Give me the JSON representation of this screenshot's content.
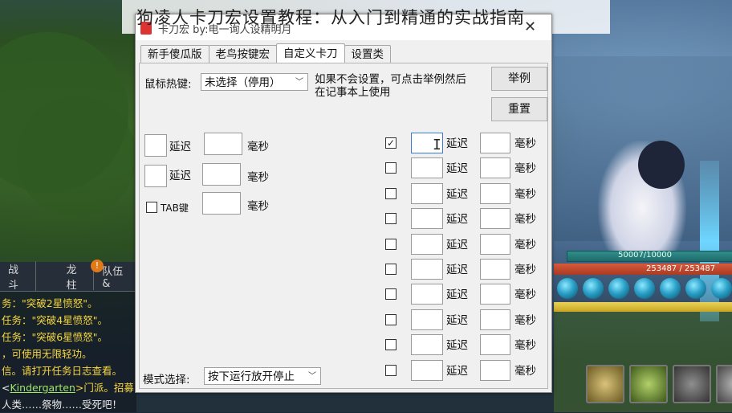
{
  "banner": {
    "title": "狗凌人卡刀宏设置教程：从入门到精通的实战指南"
  },
  "window": {
    "title": "卡刀宏 by:电一询人设精明月",
    "close": "✕"
  },
  "tabs": [
    {
      "label": "新手傻瓜版",
      "active": false
    },
    {
      "label": "老鸟按键宏",
      "active": false
    },
    {
      "label": "自定义卡刀",
      "active": true
    },
    {
      "label": "设置类",
      "active": false
    }
  ],
  "hotkey": {
    "label": "鼠标热键:",
    "value": "未选择（停用）"
  },
  "hint": {
    "line1": "如果不会设置，可点击举例然后",
    "line2": "在记事本上使用"
  },
  "buttons": {
    "example": "举例",
    "reset": "重置"
  },
  "left_rows": [
    {
      "prefix": "",
      "delay_label": "延迟",
      "unit": "毫秒"
    },
    {
      "prefix": "",
      "delay_label": "延迟",
      "unit": "毫秒"
    },
    {
      "prefix": "TAB键",
      "delay_label": "",
      "unit": "毫秒"
    }
  ],
  "right_rows": [
    {
      "checked": true,
      "delay_label": "延迟",
      "unit": "毫秒"
    },
    {
      "checked": false,
      "delay_label": "延迟",
      "unit": "毫秒"
    },
    {
      "checked": false,
      "delay_label": "延迟",
      "unit": "毫秒"
    },
    {
      "checked": false,
      "delay_label": "延迟",
      "unit": "毫秒"
    },
    {
      "checked": false,
      "delay_label": "延迟",
      "unit": "毫秒"
    },
    {
      "checked": false,
      "delay_label": "延迟",
      "unit": "毫秒"
    },
    {
      "checked": false,
      "delay_label": "延迟",
      "unit": "毫秒"
    },
    {
      "checked": false,
      "delay_label": "延迟",
      "unit": "毫秒"
    },
    {
      "checked": false,
      "delay_label": "延迟",
      "unit": "毫秒"
    },
    {
      "checked": false,
      "delay_label": "延迟",
      "unit": "毫秒"
    }
  ],
  "mode": {
    "label": "模式选择:",
    "value": "按下运行放开停止"
  },
  "checkmark": "✓",
  "game": {
    "chat_tabs": [
      "战斗",
      "龙柱",
      "队伍&"
    ],
    "chat_badge": "!",
    "chat_lines": [
      {
        "text": "务：\"突破2星愤怒\"。",
        "type": "yellow"
      },
      {
        "text": "任务：\"突破4星愤怒\"。",
        "type": "yellow"
      },
      {
        "text": "任务：\"突破6星愤怒\"。",
        "type": "yellow"
      },
      {
        "text": "，可使用无限轻功。",
        "type": "yellow"
      },
      {
        "text": "信。请打开任务日志查看。",
        "type": "yellow"
      },
      {
        "pre": "<",
        "link": "Kindergarten",
        "post": ">门派。招募",
        "type": "link"
      },
      {
        "text": "人类……祭物……受死吧！",
        "type": "white"
      }
    ],
    "hp_top_text": "50007/10000",
    "hp_red_text": "253487 / 253487"
  }
}
